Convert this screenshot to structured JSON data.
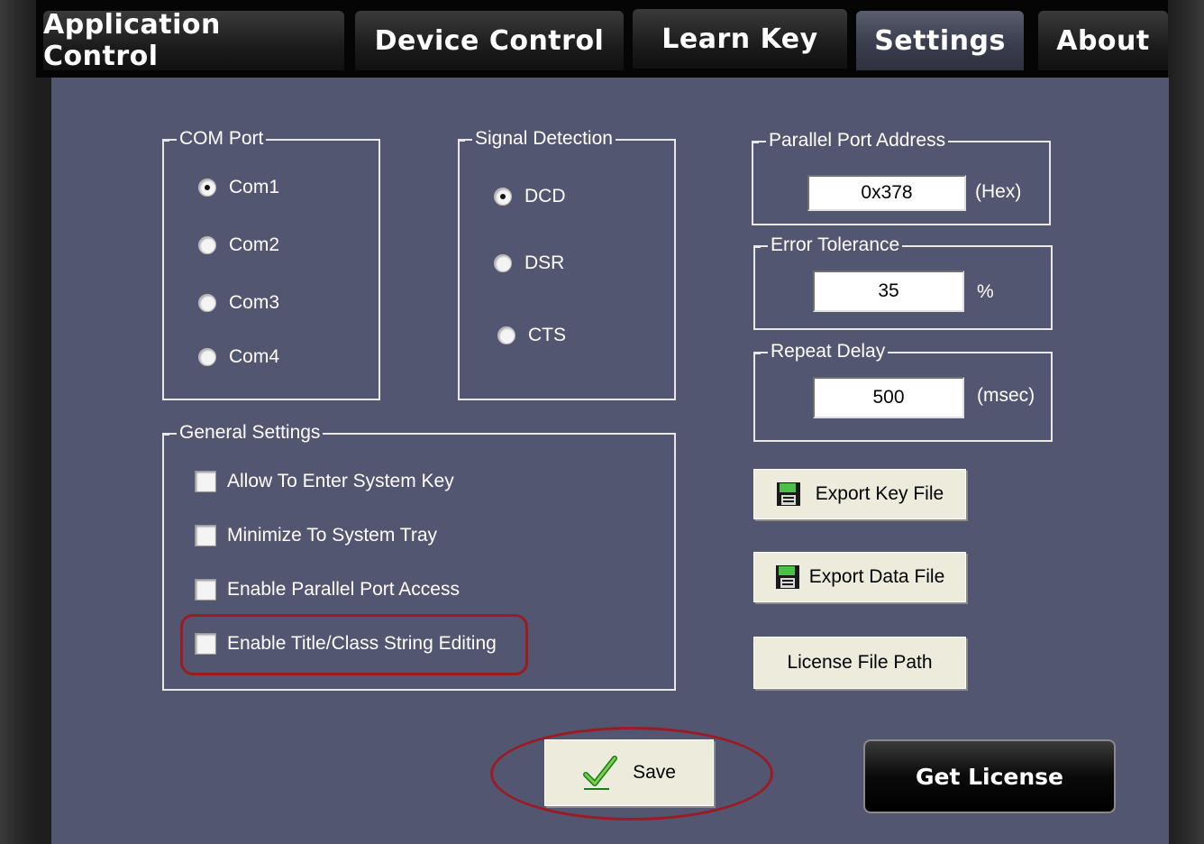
{
  "tabs": [
    {
      "label": "Application Control"
    },
    {
      "label": "Device Control"
    },
    {
      "label": "Learn Key"
    },
    {
      "label": "Settings"
    },
    {
      "label": "About"
    }
  ],
  "active_tab": "Settings",
  "com_port": {
    "title": "COM Port",
    "options": [
      "Com1",
      "Com2",
      "Com3",
      "Com4"
    ],
    "selected": "Com1"
  },
  "signal_detection": {
    "title": "Signal Detection",
    "options": [
      "DCD",
      "DSR",
      "CTS"
    ],
    "selected": "DCD"
  },
  "parallel_port": {
    "title": "Parallel Port Address",
    "value": "0x378",
    "unit": "(Hex)"
  },
  "error_tolerance": {
    "title": "Error Tolerance",
    "value": "35",
    "unit": "%"
  },
  "repeat_delay": {
    "title": "Repeat Delay",
    "value": "500",
    "unit": "(msec)"
  },
  "general_settings": {
    "title": "General Settings",
    "options": [
      {
        "label": "Allow To Enter System Key",
        "checked": false
      },
      {
        "label": "Minimize To System Tray",
        "checked": false
      },
      {
        "label": "Enable Parallel Port Access",
        "checked": false
      },
      {
        "label": "Enable Title/Class String Editing",
        "checked": false
      }
    ]
  },
  "buttons": {
    "export_key": "Export Key File",
    "export_data": "Export Data File",
    "license_path": "License File Path",
    "save": "Save",
    "get_license": "Get License"
  },
  "colors": {
    "panel": "#535671",
    "highlight": "#9b1b24",
    "active_tab": "#3d4050"
  }
}
